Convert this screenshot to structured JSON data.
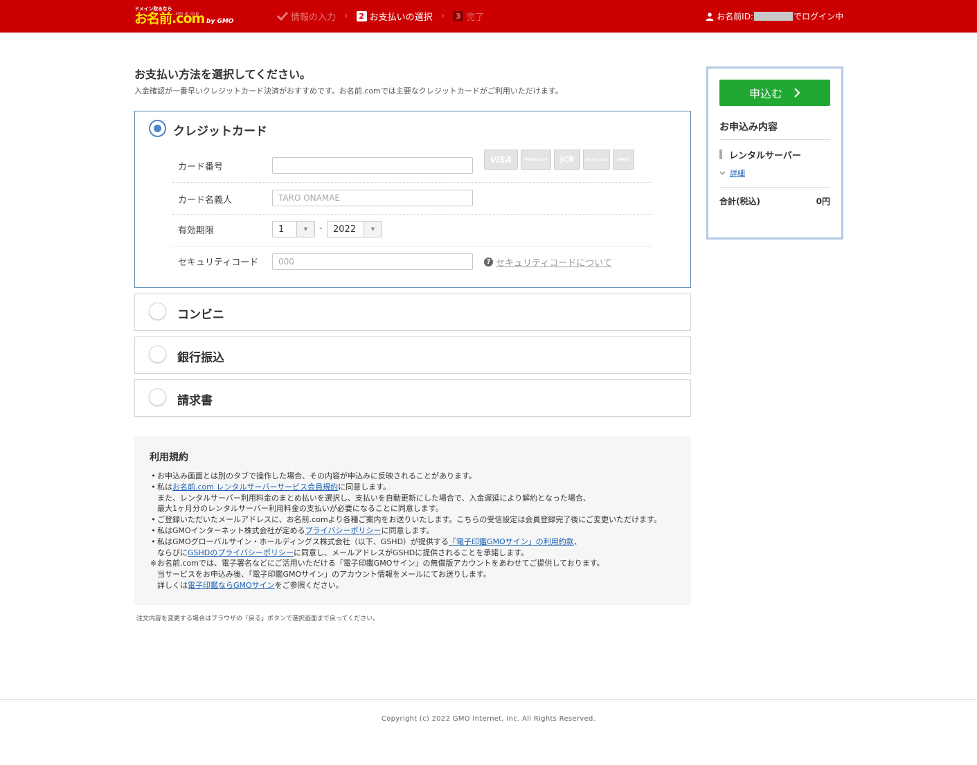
{
  "header": {
    "logo": {
      "tagline": "ドメイン取るなら",
      "brand": "お名前.com",
      "tlds": ".com .jp .co.jp",
      "company": "by GMO"
    },
    "steps": [
      {
        "num": "",
        "label": "情報の入力",
        "state": "done"
      },
      {
        "num": "2",
        "label": "お支払いの選択",
        "state": "current"
      },
      {
        "num": "3",
        "label": "完了",
        "state": "pending"
      }
    ],
    "login": {
      "prefix": "お名前ID:",
      "suffix": "でログイン中"
    }
  },
  "main": {
    "title": "お支払い方法を選択してください。",
    "subtitle": "入金確認が一番早いクレジットカード決済がおすすめです。お名前.comでは主要なクレジットカードがご利用いただけます。",
    "payment_methods": [
      {
        "label": "クレジットカード",
        "selected": true
      },
      {
        "label": "コンビニ",
        "selected": false
      },
      {
        "label": "銀行振込",
        "selected": false
      },
      {
        "label": "請求書",
        "selected": false
      }
    ],
    "credit_form": {
      "card_number_label": "カード番号",
      "card_number_value": "",
      "card_name_label": "カード名義人",
      "card_name_placeholder": "TARO ONAMAE",
      "expiry_label": "有効期限",
      "expiry_month": "1",
      "expiry_dash": "-",
      "expiry_year": "2022",
      "security_label": "セキュリティコード",
      "security_placeholder": "000",
      "security_help": "セキュリティコードについて",
      "card_brands": [
        "VISA",
        "MasterCard",
        "JCB",
        "Diners Club",
        "AMEX"
      ]
    }
  },
  "terms": {
    "title": "利用規約",
    "lines": [
      {
        "mark": "•",
        "indent": false,
        "parts": [
          {
            "t": "お申込み画面とは別のタブで操作した場合、その内容が申込みに反映されることがあります。"
          }
        ]
      },
      {
        "mark": "•",
        "indent": false,
        "parts": [
          {
            "t": "私は"
          },
          {
            "t": "お名前.com レンタルサーバーサービス会員規約",
            "link": true
          },
          {
            "t": "に同意します。"
          }
        ]
      },
      {
        "mark": "",
        "indent": true,
        "parts": [
          {
            "t": "また、レンタルサーバー利用料金のまとめ払いを選択し、支払いを自動更新にした場合で、入金遅延により解約となった場合、"
          }
        ]
      },
      {
        "mark": "",
        "indent": true,
        "parts": [
          {
            "t": "最大1ヶ月分のレンタルサーバー利用料金の支払いが必要になることに同意します。"
          }
        ]
      },
      {
        "mark": "•",
        "indent": false,
        "parts": [
          {
            "t": "ご登録いただいたメールアドレスに、お名前.comより各種ご案内をお送りいたします。こちらの受信設定は会員登録完了後にご変更いただけます。"
          }
        ]
      },
      {
        "mark": "•",
        "indent": false,
        "parts": [
          {
            "t": "私はGMOインターネット株式会社が定める"
          },
          {
            "t": "プライバシーポリシー",
            "link": true
          },
          {
            "t": "に同意します。"
          }
        ]
      },
      {
        "mark": "•",
        "indent": false,
        "parts": [
          {
            "t": "私はGMOグローバルサイン・ホールディングス株式会社（以下、GSHD）が提供する"
          },
          {
            "t": "「電子印鑑GMOサイン」の利用約款",
            "link": true
          },
          {
            "t": "、"
          }
        ]
      },
      {
        "mark": "",
        "indent": true,
        "parts": [
          {
            "t": "ならびに"
          },
          {
            "t": "GSHDのプライバシーポリシー",
            "link": true
          },
          {
            "t": "に同意し、メールアドレスがGSHDに提供されることを承諾します。"
          }
        ]
      },
      {
        "mark": "※",
        "indent": false,
        "parts": [
          {
            "t": "お名前.comでは、電子署名などにご活用いただける「電子印鑑GMOサイン」の無償版アカウントをあわせてご提供しております。"
          }
        ]
      },
      {
        "mark": "",
        "indent": true,
        "parts": [
          {
            "t": "当サービスをお申込み後、「電子印鑑GMOサイン」のアカウント情報をメールにてお送りします。"
          }
        ]
      },
      {
        "mark": "",
        "indent": true,
        "parts": [
          {
            "t": "詳しくは"
          },
          {
            "t": "電子印鑑ならGMOサイン",
            "link": true
          },
          {
            "t": "をご参照ください。"
          }
        ]
      }
    ]
  },
  "note": "注文内容を変更する場合はブラウザの「戻る」ボタンで選択画面まで戻ってください。",
  "side": {
    "apply_label": "申込む",
    "title": "お申込み内容",
    "item": "レンタルサーバー",
    "detail_label": "詳細",
    "total_label": "合計(税込)",
    "total_value": "0円"
  },
  "footer": {
    "copyright": "Copyright (c) 2022 GMO Internet, Inc. All Rights Reserved."
  },
  "colors": {
    "header_bg": "#cc0000",
    "logo_yellow": "#ffe100",
    "radio_selected": "#4a86c8",
    "apply_button": "#21a833",
    "link": "#1a5fb4",
    "side_border": "#b4c8e8"
  }
}
